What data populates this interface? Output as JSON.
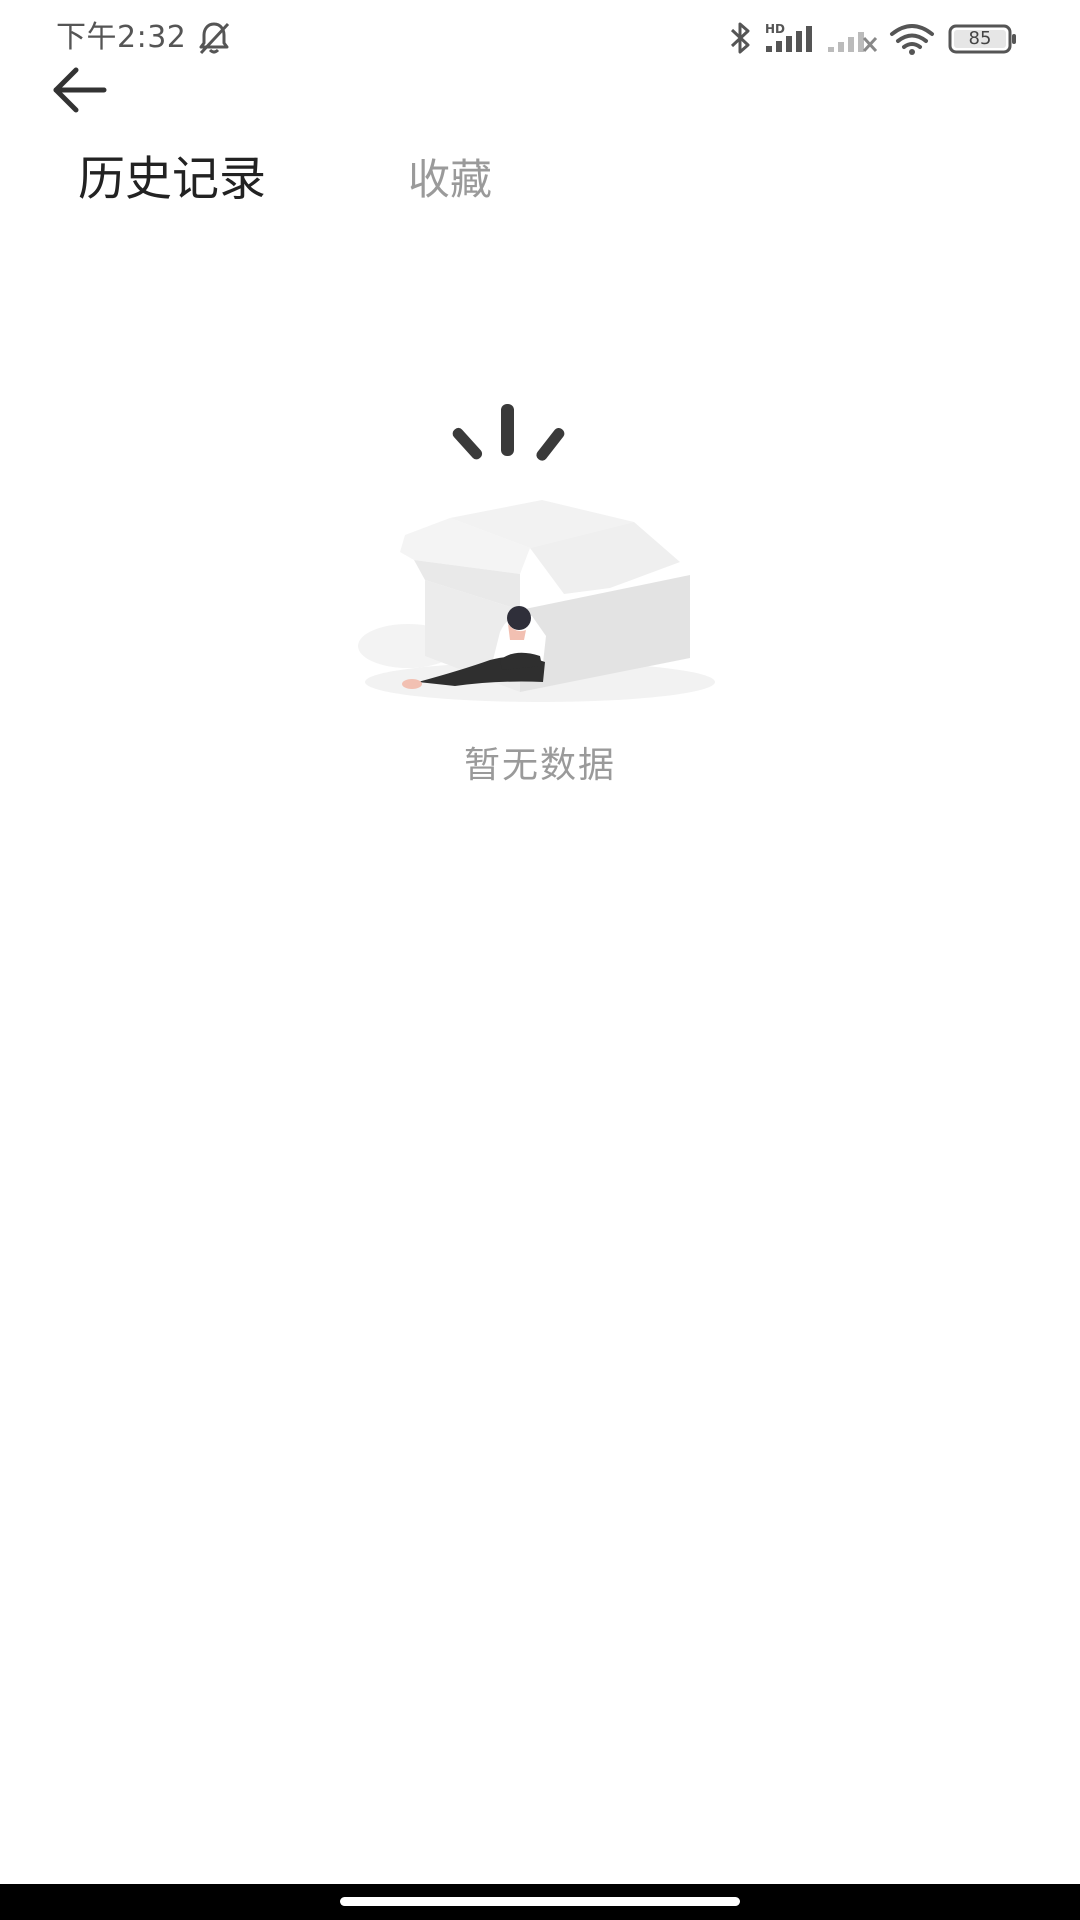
{
  "status_bar": {
    "time": "下午2:32",
    "battery_level": "85",
    "network_label": "HD",
    "icons": [
      "bell-off-icon",
      "bluetooth-icon",
      "signal-hd-icon",
      "signal-off-icon",
      "wifi-icon",
      "battery-icon"
    ]
  },
  "header": {
    "back_icon": "back-arrow-icon"
  },
  "tabs": [
    {
      "label": "历史记录",
      "active": true
    },
    {
      "label": "收藏",
      "active": false
    }
  ],
  "empty_state": {
    "illustration": "empty-box-illustration",
    "message": "暂无数据"
  },
  "colors": {
    "active_tab": "#222222",
    "inactive_tab": "#9a9a9a",
    "empty_text": "#9a9a9a",
    "nav_bar": "#000000"
  }
}
